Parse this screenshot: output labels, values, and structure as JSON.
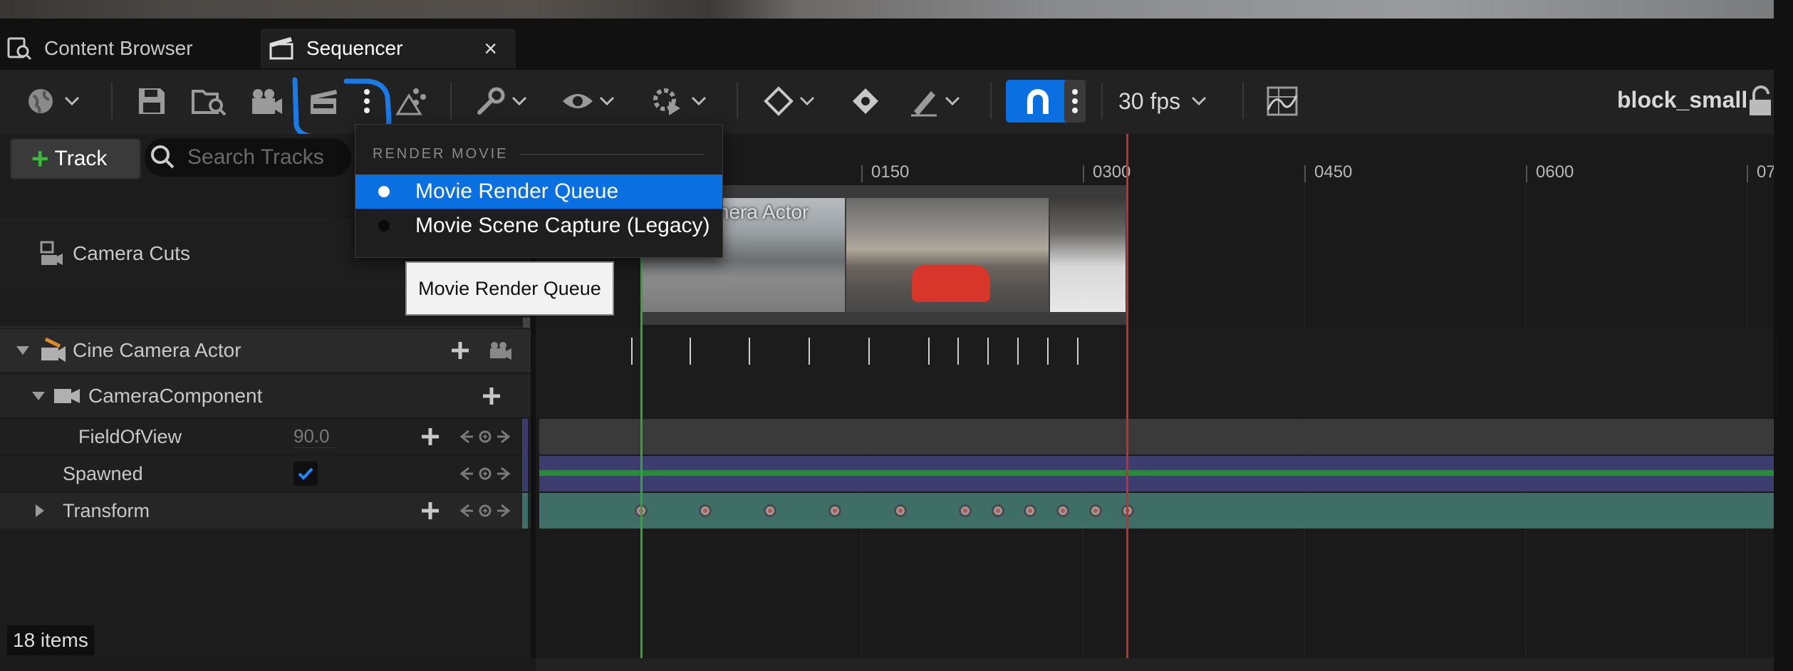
{
  "tabs": [
    {
      "label": "Content Browser"
    },
    {
      "label": "Sequencer",
      "close": "×"
    }
  ],
  "toolbar": {
    "fps_label": "30 fps",
    "sequence_name": "block_small"
  },
  "track_panel": {
    "add_track_plus": "+",
    "add_track_label": "Track",
    "search_placeholder": "Search Tracks",
    "rows": {
      "camera_cuts": "Camera Cuts",
      "cine_camera_actor": "Cine Camera Actor",
      "camera_component": "CameraComponent",
      "field_of_view": "FieldOfView",
      "field_of_view_value": "90.0",
      "spawned": "Spawned",
      "spawned_checked": true,
      "transform": "Transform"
    },
    "items_count": "18 items"
  },
  "timeline": {
    "ruler_ticks": [
      "0150",
      "0300",
      "0450",
      "0600",
      "07"
    ],
    "camera_section_label": "mera Actor"
  },
  "dropdown_menu": {
    "header": "RENDER MOVIE",
    "items": [
      {
        "label": "Movie Render Queue",
        "selected": true
      },
      {
        "label": "Movie Scene Capture (Legacy)",
        "selected": false
      }
    ]
  },
  "tooltip": {
    "text": "Movie Render Queue"
  },
  "colors": {
    "accent": "#0a6fe0",
    "annotation": "#1a7ae6",
    "playhead": "#3aa03a",
    "end_marker": "#c03030",
    "transform_track": "#3e6e66",
    "spawned_track": "#3c3c6e"
  }
}
